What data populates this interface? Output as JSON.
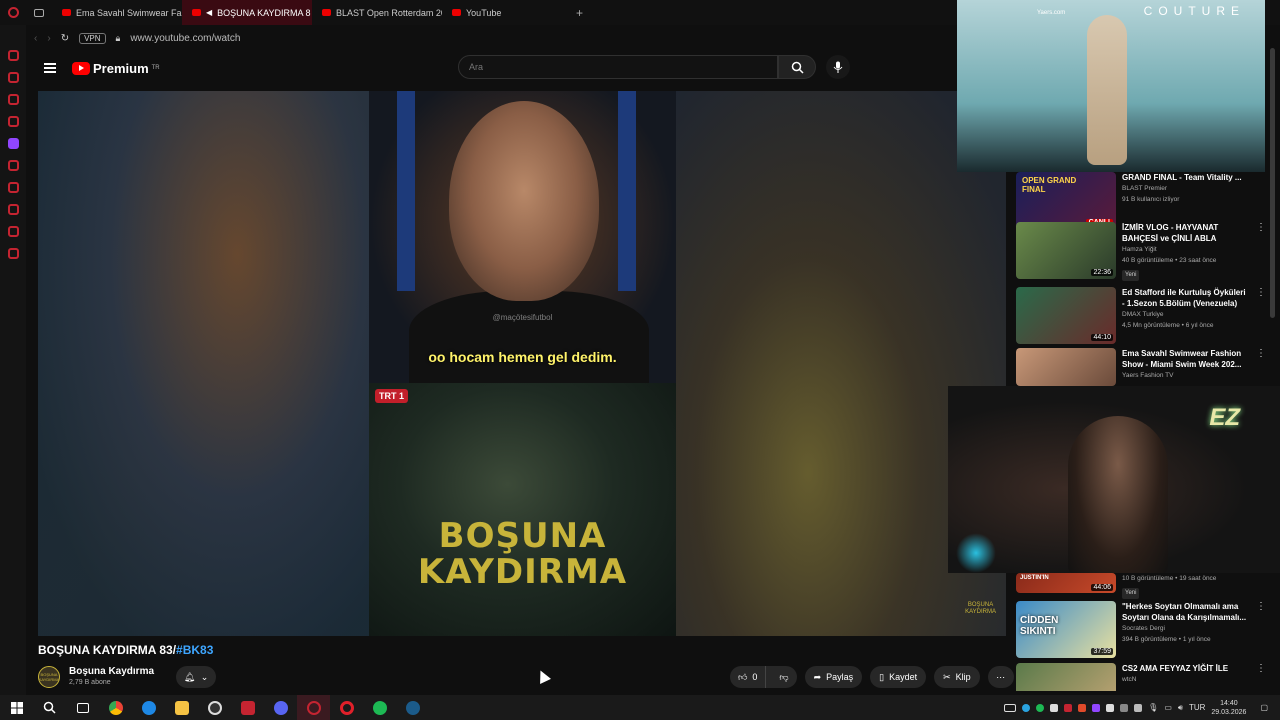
{
  "browser": {
    "tabs": [
      {
        "label": "Ema Savahl Swimwear Fa",
        "active": false
      },
      {
        "label": "BOŞUNA KAYDIRMA 8",
        "active": true
      },
      {
        "label": "BLAST Open Rotterdam 20",
        "active": false
      },
      {
        "label": "YouTube",
        "active": false
      }
    ],
    "vpn_label": "VPN",
    "url": "www.youtube.com/watch"
  },
  "youtube": {
    "logo_text": "Premium",
    "logo_region": "TR",
    "search_placeholder": "Ara"
  },
  "video": {
    "watermark": "@maçötesifutbol",
    "subtitle": "oo hocam hemen gel dedim.",
    "tv_logo": "TRT 1",
    "big_title_line1": "BOŞUNA",
    "big_title_line2": "KAYDIRMA",
    "corner_logo_line1": "BOŞUNA",
    "corner_logo_line2": "KAYDIRMA",
    "title": "BOŞUNA KAYDIRMA 83/",
    "title_tag": "#BK83"
  },
  "channel": {
    "avatar_text": "BOŞUNA KAYDIRMA",
    "name": "Boşuna Kaydırma",
    "subscribers": "2,79 B abone"
  },
  "actions": {
    "like_count": "0",
    "share_label": "Paylaş",
    "save_label": "Kaydet",
    "clip_label": "Klip"
  },
  "overlay": {
    "brand_text": "COUTURE",
    "small_text": "Yaers.com"
  },
  "cam": {
    "logo": "EZ"
  },
  "recommendations": [
    {
      "title": "GRAND FINAL - Team Vitality ...",
      "channel": "BLAST Premier",
      "meta": "91 B kullanıcı izliyor",
      "badge": "CANLI",
      "yeni": ""
    },
    {
      "title": "İZMİR VLOG - HAYVANAT BAHÇESİ ve ÇİNLİ ABLA",
      "channel": "Hamza Yiğit",
      "meta": "40 B görüntüleme • 23 saat önce",
      "badge": "22:36",
      "yeni": "Yeni"
    },
    {
      "title": "Ed Stafford ile Kurtuluş Öyküleri - 1.Sezon 5.Bölüm (Venezuela)",
      "channel": "DMAX Turkiye",
      "meta": "4,5 Mn görüntüleme • 6 yıl önce",
      "badge": "44:10",
      "yeni": ""
    },
    {
      "title": "Ema Savahl Swimwear Fashion Show - Miami Swim Week 202...",
      "channel": "Yaers Fashion TV",
      "meta": "",
      "badge": "",
      "yeni": ""
    },
    {
      "title": "",
      "channel": "",
      "meta": "10 B görüntüleme • 19 saat önce",
      "badge": "44:06",
      "yeni": "Yeni"
    },
    {
      "title": "\"Herkes Soytarı Olmamalı ama Soytarı Olana da Karışılmamalı...",
      "channel": "Socrates Dergi",
      "meta": "394 B görüntüleme • 1 yıl önce",
      "badge": "37:59",
      "yeni": ""
    },
    {
      "title": "CS2 AMA FEYYAZ YİĞİT İLE",
      "channel": "wtcN",
      "meta": "",
      "badge": "",
      "yeni": ""
    }
  ],
  "rec_thumb_texts": {
    "open_grand_final": "OPEN GRAND FINAL",
    "justin": "JUSTIN'IN",
    "ciddensikint": "CİDDEN SIKINTI"
  },
  "taskbar": {
    "lang": "TUR",
    "time": "14:40",
    "date": "29.03.2026"
  },
  "colors": {
    "yt_red": "#ff0000",
    "opera_red": "#c42431",
    "subtitle_yellow": "#fff36a",
    "title_gold": "#c8b43a",
    "link_blue": "#3ea6ff"
  }
}
